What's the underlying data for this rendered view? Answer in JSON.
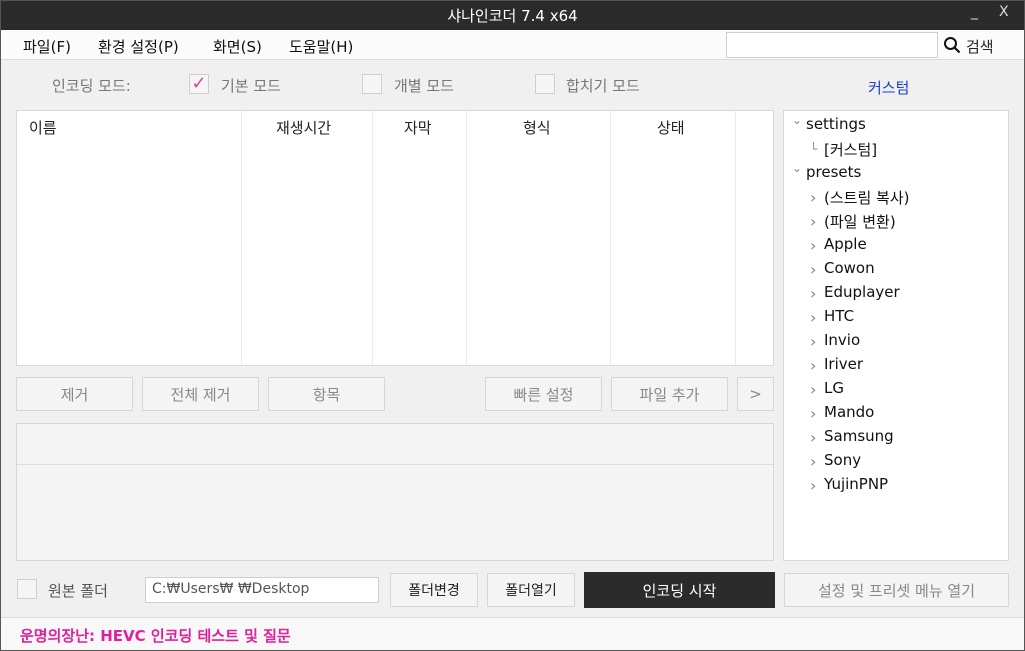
{
  "window": {
    "title": "샤나인코더  7.4 x64",
    "minimize": "_",
    "close": "X"
  },
  "menu": {
    "items": [
      "파일(F)",
      "환경 설정(P)",
      "화면(S)",
      "도움말(H)"
    ],
    "search_placeholder": "",
    "search_label": "검색"
  },
  "mode": {
    "label": "인코딩 모드:",
    "options": [
      {
        "label": "기본 모드",
        "checked": true
      },
      {
        "label": "개별 모드",
        "checked": false
      },
      {
        "label": "합치기 모드",
        "checked": false
      }
    ],
    "custom_link": "커스텀"
  },
  "file_list": {
    "columns": [
      "이름",
      "재생시간",
      "자막",
      "형식",
      "상태"
    ],
    "rows": []
  },
  "tree": {
    "nodes": [
      {
        "label": "settings",
        "level": 0,
        "caret": "expanded"
      },
      {
        "label": "[커스텀]",
        "level": 1,
        "caret": "leaf"
      },
      {
        "label": "presets",
        "level": 0,
        "caret": "expanded"
      },
      {
        "label": "(스트림 복사)",
        "level": 1,
        "caret": "collapsed"
      },
      {
        "label": "(파일 변환)",
        "level": 1,
        "caret": "collapsed"
      },
      {
        "label": "Apple",
        "level": 1,
        "caret": "collapsed"
      },
      {
        "label": "Cowon",
        "level": 1,
        "caret": "collapsed"
      },
      {
        "label": "Eduplayer",
        "level": 1,
        "caret": "collapsed"
      },
      {
        "label": "HTC",
        "level": 1,
        "caret": "collapsed"
      },
      {
        "label": "Invio",
        "level": 1,
        "caret": "collapsed"
      },
      {
        "label": "Iriver",
        "level": 1,
        "caret": "collapsed"
      },
      {
        "label": "LG",
        "level": 1,
        "caret": "collapsed"
      },
      {
        "label": "Mando",
        "level": 1,
        "caret": "collapsed"
      },
      {
        "label": "Samsung",
        "level": 1,
        "caret": "collapsed"
      },
      {
        "label": "Sony",
        "level": 1,
        "caret": "collapsed"
      },
      {
        "label": "YujinPNP",
        "level": 1,
        "caret": "collapsed"
      }
    ]
  },
  "list_buttons": {
    "remove": "제거",
    "remove_all": "전체 제거",
    "items": "항목",
    "quick_settings": "빠른 설정",
    "add_file": "파일 추가",
    "more": ">"
  },
  "bottom": {
    "original_folder_label": "원본 폴더",
    "original_folder_checked": false,
    "folder_path": "C:₩Users₩    ₩Desktop",
    "change_folder": "폴더변경",
    "open_folder": "폴더열기",
    "start_encoding": "인코딩 시작",
    "open_settings_menu": "설정 및 프리셋 메뉴 열기"
  },
  "status": {
    "text": "운명의장난: HEVC 인코딩 테스트 및 질문"
  },
  "colors": {
    "accent_pink": "#e0209a",
    "link_blue": "#1a3ecf",
    "titlebar": "#2b2b2b"
  }
}
